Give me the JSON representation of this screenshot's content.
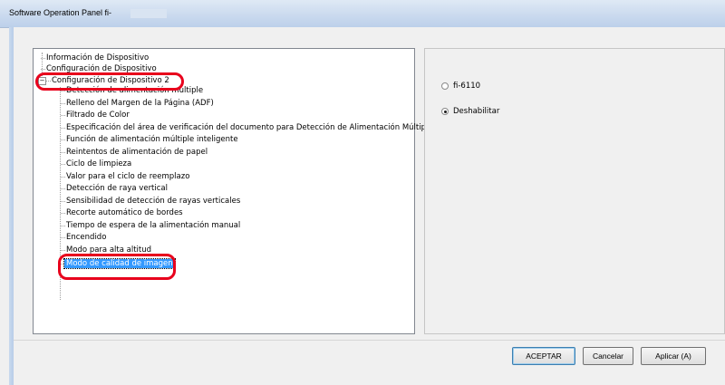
{
  "window": {
    "title": "Software Operation Panel fi-"
  },
  "tree": {
    "items": [
      {
        "label": "Información de Dispositivo"
      },
      {
        "label": "Configuración de Dispositivo"
      },
      {
        "label": "Configuración de Dispositivo 2",
        "expander": "−"
      },
      {
        "label": "Detección de alimentación múltiple"
      },
      {
        "label": "Relleno del Margen de la Página (ADF)"
      },
      {
        "label": "Filtrado de Color"
      },
      {
        "label": "Especificación del área de verificación del documento para Detección de Alimentación Múltiple"
      },
      {
        "label": "Función de alimentación múltiple inteligente"
      },
      {
        "label": "Reintentos de alimentación de papel"
      },
      {
        "label": "Ciclo de limpieza"
      },
      {
        "label": "Valor para el ciclo de reemplazo"
      },
      {
        "label": "Detección de raya vertical"
      },
      {
        "label": "Sensibilidad de detección de rayas verticales"
      },
      {
        "label": "Recorte automático de bordes"
      },
      {
        "label": "Tiempo de espera de la alimentación manual"
      },
      {
        "label": "Encendido"
      },
      {
        "label": "Modo para alta altitud"
      },
      {
        "label": "Modo de calidad de imagen"
      }
    ]
  },
  "options": {
    "radio1_label": "fi-6110",
    "radio2_label": "Deshabilitar",
    "selected": "Deshabilitar"
  },
  "buttons": {
    "ok": "ACEPTAR",
    "cancel": "Cancelar",
    "apply": "Aplicar (A)"
  },
  "colors": {
    "selection": "#3399ff",
    "highlight_ring": "#e8001c"
  }
}
